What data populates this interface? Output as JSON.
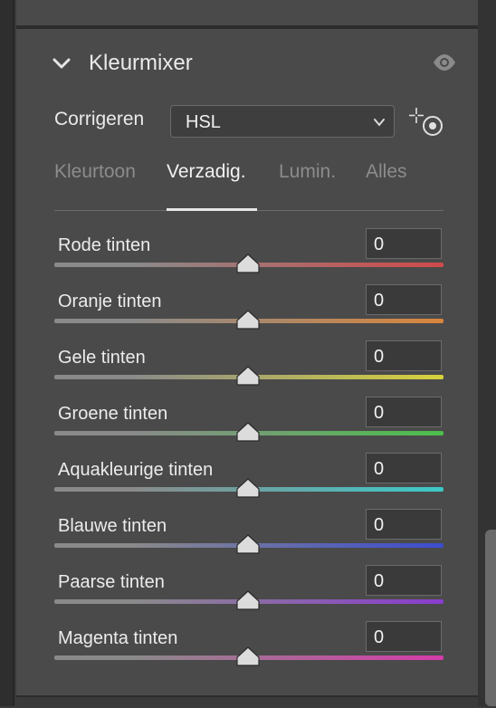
{
  "header": {
    "title": "Kleurmixer"
  },
  "correct": {
    "label": "Corrigeren",
    "value": "HSL"
  },
  "tabs": [
    "Kleurtoon",
    "Verzadig.",
    "Lumin.",
    "Alles"
  ],
  "active_tab": "Verzadig.",
  "sliders": [
    {
      "label": "Rode tinten",
      "value": "0",
      "color": "#d14a4a"
    },
    {
      "label": "Oranje tinten",
      "value": "0",
      "color": "#d9853c"
    },
    {
      "label": "Gele tinten",
      "value": "0",
      "color": "#d6d23c"
    },
    {
      "label": "Groene tinten",
      "value": "0",
      "color": "#4cbf4c"
    },
    {
      "label": "Aquakleurige tinten",
      "value": "0",
      "color": "#3cc9c9"
    },
    {
      "label": "Blauwe tinten",
      "value": "0",
      "color": "#3c4ccf"
    },
    {
      "label": "Paarse tinten",
      "value": "0",
      "color": "#8a3ccf"
    },
    {
      "label": "Magenta tinten",
      "value": "0",
      "color": "#d43caa"
    }
  ]
}
